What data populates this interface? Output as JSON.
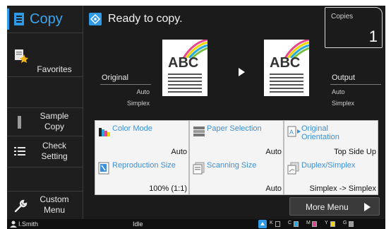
{
  "app": {
    "title": "Copy"
  },
  "header": {
    "status_text": "Ready to copy."
  },
  "copies": {
    "label": "Copies",
    "value": "1"
  },
  "sidebar": {
    "items": [
      {
        "label_line1": "Favorites",
        "label_line2": "",
        "icon": "favorites-star-icon"
      },
      {
        "label_line1": "Sample",
        "label_line2": "Copy",
        "icon": "sample-copy-icon"
      },
      {
        "label_line1": "Check",
        "label_line2": "Setting",
        "icon": "list-icon"
      },
      {
        "label_line1": "Custom",
        "label_line2": "Menu",
        "icon": "wrench-icon"
      }
    ]
  },
  "preview": {
    "original_label": "Original",
    "original_line1": "Auto",
    "original_line2": "Simplex",
    "output_label": "Output",
    "output_line1": "Auto",
    "output_line2": "Simplex",
    "doc_text": "ABC"
  },
  "functions": [
    {
      "title_line1": "Color Mode",
      "title_line2": "",
      "value": "Auto",
      "icon": "color-mode-icon"
    },
    {
      "title_line1": "Paper Selection",
      "title_line2": "",
      "value": "Auto",
      "icon": "paper-tray-icon"
    },
    {
      "title_line1": "Original",
      "title_line2": "Orientation",
      "value": "Top Side Up",
      "icon": "orientation-icon"
    },
    {
      "title_line1": "Reproduction Size",
      "title_line2": "",
      "value": "100% (1:1)",
      "icon": "reproduction-size-icon"
    },
    {
      "title_line1": "Scanning Size",
      "title_line2": "",
      "value": "Auto",
      "icon": "scanning-size-icon"
    },
    {
      "title_line1": "Duplex/Simplex",
      "title_line2": "",
      "value": "Simplex -> Simplex",
      "icon": "duplex-icon"
    }
  ],
  "more_menu": {
    "label": "More Menu"
  },
  "status_bar": {
    "user": "I.Smith",
    "state": "Idle",
    "toner": [
      {
        "label": "K",
        "color": "#111111"
      },
      {
        "label": "C",
        "color": "#29a8e0"
      },
      {
        "label": "M",
        "color": "#e2458f"
      },
      {
        "label": "Y",
        "color": "#f1d500"
      },
      {
        "label": "G",
        "color": "#9a9a9a"
      }
    ]
  },
  "colors": {
    "accent": "#2f9be8",
    "tile_title": "#3c8fd6",
    "background": "#1b1b1b"
  }
}
